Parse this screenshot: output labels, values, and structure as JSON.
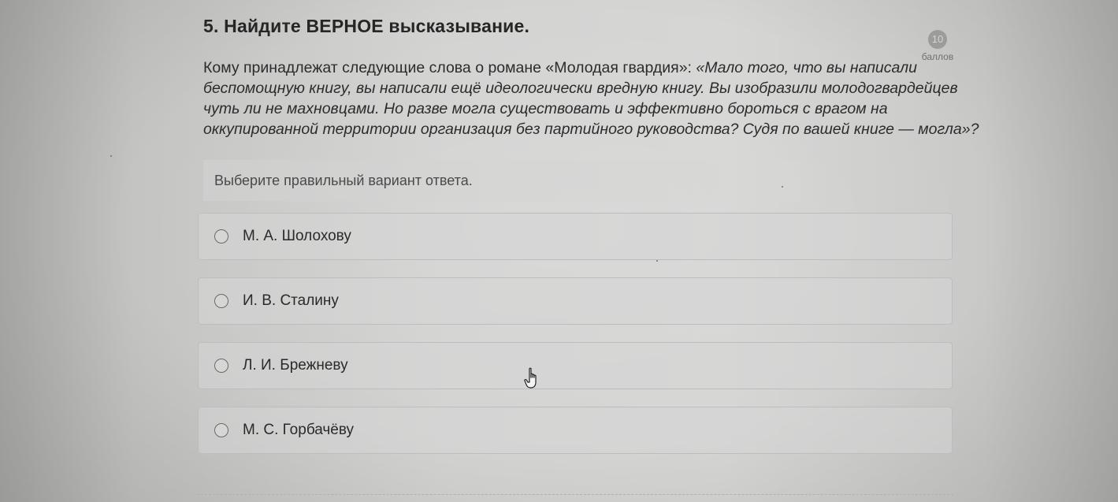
{
  "question": {
    "title": "5. Найдите ВЕРНОЕ высказывание.",
    "points_value": "10",
    "points_label": "баллов",
    "text_lines": [
      {
        "lead": "Кому принадлежат следующие слова о романе «Молодая гвардия»: ",
        "italic": "«Мало того, что вы написали"
      },
      {
        "lead": "",
        "italic": "беспомощную книгу, вы написали ещё идеологически вредную книгу. Вы изобразили молодогвардейцев"
      },
      {
        "lead": "",
        "italic": "чуть ли не махновцами. Но разве могла существовать и эффективно бороться с врагом на"
      },
      {
        "lead": "",
        "italic": "оккупированной территории организация без партийного руководства? Судя по вашей книге — могла»?"
      }
    ],
    "instruction": "Выберите правильный вариант ответа.",
    "options": [
      {
        "label": "М. А. Шолохову",
        "selected": false
      },
      {
        "label": "И. В. Сталину",
        "selected": false
      },
      {
        "label": "Л. И. Брежневу",
        "selected": false
      },
      {
        "label": "М. С. Горбачёву",
        "selected": false
      }
    ]
  },
  "colors": {
    "background": "#d3d3d2",
    "badge": "#9c9c9b",
    "text": "#2a2a2a"
  },
  "icons": {
    "cursor": "hand-pointer-icon",
    "radio": "radio-circle-icon"
  }
}
